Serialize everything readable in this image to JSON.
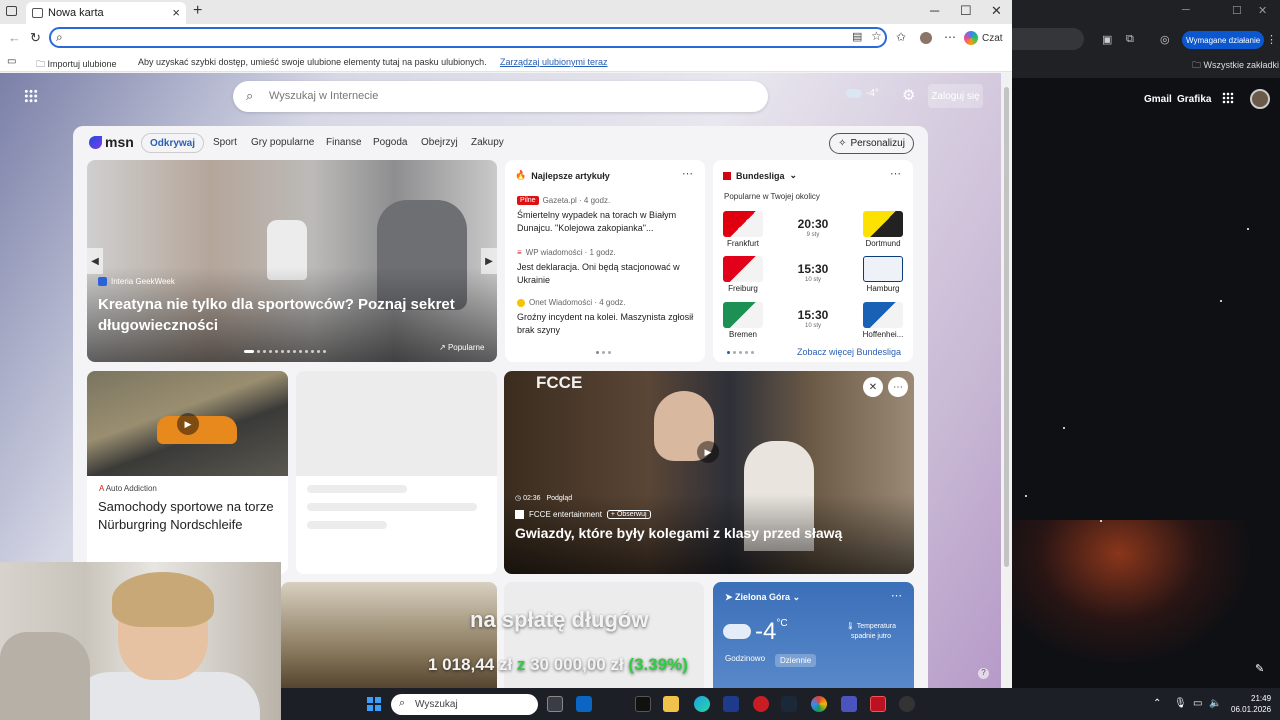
{
  "browser": {
    "tab_title": "Nowa karta",
    "new_tab": "+",
    "address_value": "",
    "czat": "Czat",
    "favbar_import": "Importuj ulubione",
    "favbar_hint": "Aby uzyskać szybki dostęp, umieść swoje ulubione elementy tutaj na pasku ulubionych.",
    "favbar_link": "Zarządzaj ulubionymi teraz"
  },
  "page": {
    "search_placeholder": "Wyszukaj w Internecie",
    "weather_temp": "-4°",
    "login": "Zaloguj się"
  },
  "msn": {
    "logo": "msn",
    "nav": [
      "Odkrywaj",
      "Sport",
      "Gry popularne",
      "Finanse",
      "Pogoda",
      "Obejrzyj",
      "Zakupy"
    ],
    "personalize": "Personalizuj",
    "hero": {
      "source": "Interia GeekWeek",
      "title": "Kreatyna nie tylko dla sportowców? Poznaj sekret długowieczności",
      "badge": "Popularne"
    },
    "top_articles": {
      "title": "Najlepsze artykuły",
      "items": [
        {
          "badge": "Pilne",
          "source": "Gazeta.pl · 4 godz.",
          "headline": "Śmiertelny wypadek na torach w Białym Dunajcu. \"Kolejowa zakopianka\"..."
        },
        {
          "badge": "",
          "source": "WP wiadomości · 1 godz.",
          "headline": "Jest deklaracja. Oni będą stacjonować w Ukrainie"
        },
        {
          "badge": "",
          "source": "Onet Wiadomości · 4 godz.",
          "headline": "Groźny incydent na kolei. Maszynista zgłosił brak szyny"
        }
      ]
    },
    "bundesliga": {
      "title": "Bundesliga",
      "subtitle": "Popularne w Twojej okolicy",
      "matches": [
        {
          "home": "Frankfurt",
          "away": "Dortmund",
          "time": "20:30",
          "date": "9 sty"
        },
        {
          "home": "Freiburg",
          "away": "Hamburg",
          "time": "15:30",
          "date": "10 sty"
        },
        {
          "home": "Bremen",
          "away": "Hoffenhei...",
          "time": "15:30",
          "date": "10 sty"
        }
      ],
      "see_all": "Zobacz więcej Bundesliga"
    },
    "car_card": {
      "source": "Auto Addiction",
      "title": "Samochody sportowe na torze Nürburgring Nordschleife"
    },
    "video_card": {
      "watermark": "FCCE",
      "duration": "02:36",
      "preview": "Podgląd",
      "source": "FCCE entertainment",
      "follow": "+ Obserwuj",
      "title": "Gwiazdy, które były kolegami z klasy przed sławą"
    },
    "weather_card": {
      "city": "Zielona Góra",
      "temp": "-4",
      "unit": "°C",
      "note": "Temperatura spadnie jutro",
      "tab_hourly": "Godzinowo",
      "tab_daily": "Dziennie"
    }
  },
  "overlay": {
    "line1": "na spłatę długów",
    "amount": "1 018,44 zł",
    "of": "z",
    "total": "30 000,00 zł",
    "percent": "(3.39%)"
  },
  "chrome": {
    "required_action": "Wymagane działanie",
    "all_bookmarks": "Wszystkie zakładki",
    "gmail": "Gmail",
    "images": "Grafika"
  },
  "taskbar": {
    "search": "Wyszukaj",
    "time": "21:49",
    "date": "06.01.2026"
  }
}
